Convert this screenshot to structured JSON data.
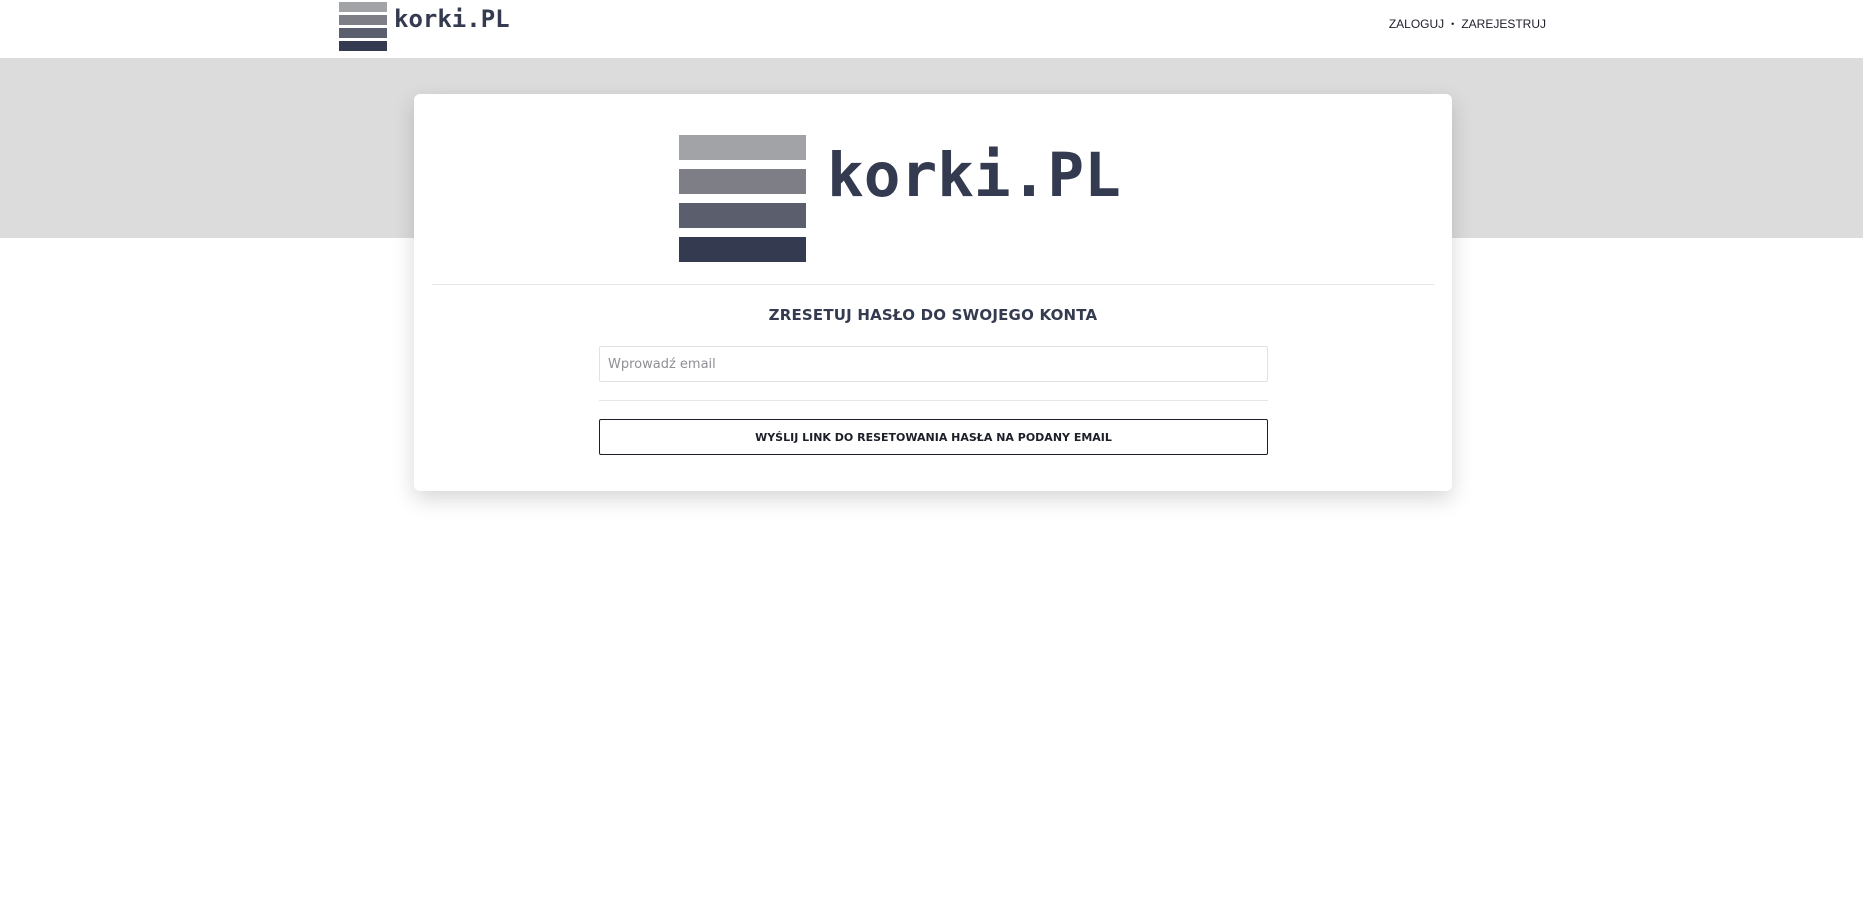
{
  "brand": {
    "name": "korki.PL"
  },
  "nav": {
    "login_label": "ZALOGUJ",
    "separator": "•",
    "register_label": "ZAREJESTRUJ"
  },
  "reset_form": {
    "title": "ZRESETUJ HASŁO DO SWOJEGO KONTA",
    "email_placeholder": "Wprowadź email",
    "email_value": "",
    "submit_label": "WYŚLIJ LINK DO RESETOWANIA HASŁA NA PODANY EMAIL"
  },
  "colors": {
    "brand_dark": "#343a4f",
    "logo_bar_1": "#a2a3a7",
    "logo_bar_2": "#7d7e86",
    "logo_bar_3": "#5b5e6c",
    "logo_bar_4": "#343a4f",
    "band_background": "#dcdcdc"
  },
  "icons": {
    "logo": "stacked-bars-logo-icon"
  }
}
